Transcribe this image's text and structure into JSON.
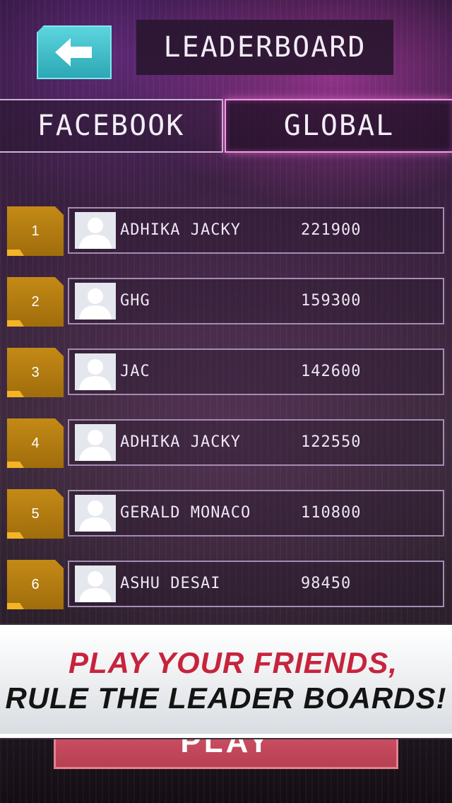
{
  "header": {
    "title": "LEADERBOARD",
    "back_icon": "arrow-left-icon"
  },
  "tabs": [
    {
      "label": "FACEBOOK",
      "active": false
    },
    {
      "label": "GLOBAL",
      "active": true
    }
  ],
  "leaderboard": {
    "entries": [
      {
        "rank": "1",
        "name": "ADHIKA JACKY",
        "score": "221900"
      },
      {
        "rank": "2",
        "name": "GHG",
        "score": "159300"
      },
      {
        "rank": "3",
        "name": "JAC",
        "score": "142600"
      },
      {
        "rank": "4",
        "name": "ADHIKA JACKY",
        "score": "122550"
      },
      {
        "rank": "5",
        "name": "GERALD MONACO",
        "score": "110800"
      },
      {
        "rank": "6",
        "name": "ASHU DESAI",
        "score": "98450"
      }
    ]
  },
  "play_button": {
    "label": "PLAY"
  },
  "promo": {
    "line1": "PLAY YOUR FRIENDS,",
    "line2": "RULE THE LEADER BOARDS!"
  },
  "colors": {
    "back_button": "#3fc1cc",
    "rank_badge": "#b67d12",
    "promo_red": "#c6243d",
    "active_tab_glow": "#f09be0"
  }
}
